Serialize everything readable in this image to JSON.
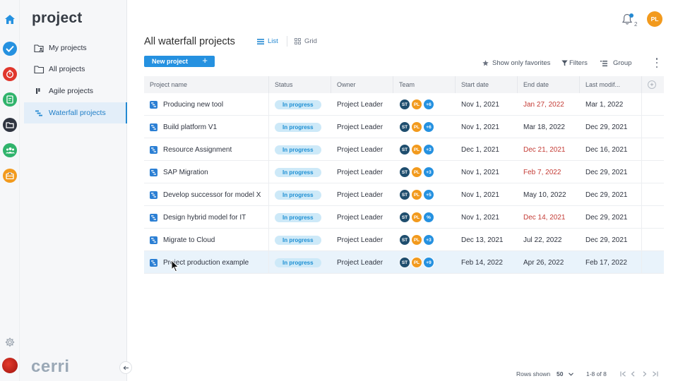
{
  "app": {
    "title": "project",
    "brand": "cerri",
    "accent": "#2489d2"
  },
  "rail": [
    {
      "icon": "home-icon",
      "color": "#2591e0"
    },
    {
      "icon": "check-icon",
      "color": "#2591e0"
    },
    {
      "icon": "timer-icon",
      "color": "#e0362c"
    },
    {
      "icon": "document-icon",
      "color": "#2fb36b"
    },
    {
      "icon": "folder-icon",
      "color": "#2f3440"
    },
    {
      "icon": "team-icon",
      "color": "#2fb36b"
    },
    {
      "icon": "briefcase-icon",
      "color": "#f29a1d"
    }
  ],
  "sidebar": {
    "items": [
      {
        "label": "My projects",
        "icon": "user-folder-icon"
      },
      {
        "label": "All projects",
        "icon": "folder-icon"
      },
      {
        "label": "Agile projects",
        "icon": "agile-board-icon"
      },
      {
        "label": "Waterfall projects",
        "icon": "waterfall-icon",
        "active": true
      }
    ]
  },
  "topbar": {
    "notifications": "2",
    "user_initials": "PL"
  },
  "header": {
    "title": "All waterfall projects",
    "tabs": [
      {
        "label": "List",
        "active": true
      },
      {
        "label": "Grid"
      }
    ],
    "new_project": "New project",
    "favorites": "Show only favorites",
    "filters": "Filters",
    "group": "Group"
  },
  "table": {
    "columns": [
      "Project name",
      "Status",
      "Owner",
      "Team",
      "Start date",
      "End date",
      "Last modif..."
    ],
    "rows": [
      {
        "name": "Producing new tool",
        "status": "In progress",
        "owner": "Project Leader",
        "team": [
          "ST",
          "PL",
          "+6"
        ],
        "start": "Nov 1, 2021",
        "end": "Jan 27, 2022",
        "end_late": true,
        "modified": "Mar 1, 2022"
      },
      {
        "name": "Build platform V1",
        "status": "In progress",
        "owner": "Project Leader",
        "team": [
          "ST",
          "PL",
          "+6"
        ],
        "start": "Nov 1, 2021",
        "end": "Mar 18, 2022",
        "end_late": false,
        "modified": "Dec 29, 2021"
      },
      {
        "name": "Resource Assignment",
        "status": "In progress",
        "owner": "Project Leader",
        "team": [
          "ST",
          "PL",
          "+3"
        ],
        "start": "Dec 1, 2021",
        "end": "Dec 21, 2021",
        "end_late": true,
        "modified": "Dec 16, 2021"
      },
      {
        "name": "SAP Migration",
        "status": "In progress",
        "owner": "Project Leader",
        "team": [
          "ST",
          "PL",
          "+3"
        ],
        "start": "Nov 1, 2021",
        "end": "Feb 7, 2022",
        "end_late": true,
        "modified": "Dec 29, 2021"
      },
      {
        "name": "Develop successor for model X",
        "status": "In progress",
        "owner": "Project Leader",
        "team": [
          "ST",
          "PL",
          "+5"
        ],
        "start": "Nov 1, 2021",
        "end": "May 10, 2022",
        "end_late": false,
        "modified": "Dec 29, 2021"
      },
      {
        "name": "Design hybrid model for IT",
        "status": "In progress",
        "owner": "Project Leader",
        "team": [
          "ST",
          "PL",
          "%"
        ],
        "start": "Nov 1, 2021",
        "end": "Dec 14, 2021",
        "end_late": true,
        "modified": "Dec 29, 2021"
      },
      {
        "name": "Migrate to Cloud",
        "status": "In progress",
        "owner": "Project Leader",
        "team": [
          "ST",
          "PL",
          "+3"
        ],
        "start": "Dec 13, 2021",
        "end": "Jul 22, 2022",
        "end_late": false,
        "modified": "Dec 29, 2021"
      },
      {
        "name": "Project production example",
        "status": "In progress",
        "owner": "Project Leader",
        "team": [
          "ST",
          "PL",
          "+9"
        ],
        "start": "Feb 14, 2022",
        "end": "Apr 26, 2022",
        "end_late": false,
        "modified": "Feb 17, 2022",
        "hover": true
      }
    ]
  },
  "footer": {
    "rows_label": "Rows shown",
    "rows_value": "50",
    "range": "1-8 of 8"
  }
}
